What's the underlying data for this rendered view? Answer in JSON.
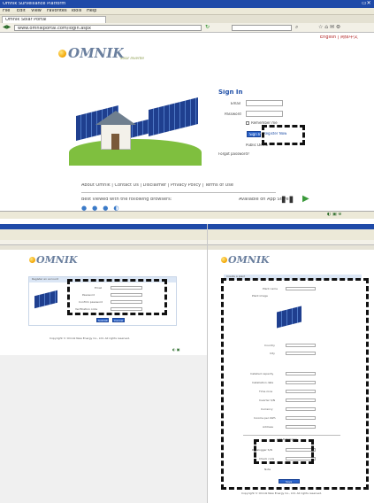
{
  "top_window": {
    "title": "Omnik Surveillance Platform",
    "menu": [
      "File",
      "Edit",
      "View",
      "Favorites",
      "Tools",
      "Help"
    ],
    "tab": "Omnik Solar Portal",
    "address": "www.omnikportal.com/login.aspx"
  },
  "brand": {
    "logo": "OMNIK",
    "tagline": "Solar Inverter"
  },
  "language_links": "English | 简体中文",
  "signin": {
    "title": "Sign In",
    "email_label": "Email",
    "password_label": "Password",
    "remember_label": "Remember me",
    "signin_button": "Sign In",
    "register_button": "Register Now",
    "demo_label": "Public Demo",
    "forgot_label": "Forgot password?"
  },
  "footer": {
    "links": "About Omnik | Contact Us | Disclaimer | Privacy Policy | Terms of Use",
    "browser_note": "Best viewed with the following browsers:",
    "app_label": "Available on App Store"
  },
  "bottom_left": {
    "header": "Register an account",
    "rows": [
      {
        "label": "Email"
      },
      {
        "label": "Password"
      },
      {
        "label": "Confirm password"
      },
      {
        "label": "Verification code"
      }
    ],
    "submit": "Submit",
    "cancel": "Cancel",
    "footer": "Copyright © Omnik New Energy Co., Ltd. All rights reserved."
  },
  "bottom_right": {
    "header": "Create a plant",
    "rows": [
      {
        "label": "Plant name"
      },
      {
        "label": "Plant image"
      },
      {
        "label": "Country"
      },
      {
        "label": "City"
      },
      {
        "label": "Installed capacity"
      },
      {
        "label": "Installation date"
      },
      {
        "label": "Time zone"
      },
      {
        "label": "Inverter S/N"
      },
      {
        "label": "Currency"
      },
      {
        "label": "Income per kWh"
      },
      {
        "label": "Address"
      }
    ],
    "device_section": "Add Datalogger",
    "device_rows": [
      {
        "label": "Datalogger S/N"
      },
      {
        "label": "Check code"
      },
      {
        "label": "Note"
      }
    ],
    "save": "Save",
    "footer": "Copyright © Omnik New Energy Co., Ltd. All rights reserved."
  },
  "colors": {
    "window_title": "#1f4aa8",
    "signin_title": "#2050a8",
    "button_blue": "#2b63c9",
    "dashed_highlight": "#111111"
  }
}
